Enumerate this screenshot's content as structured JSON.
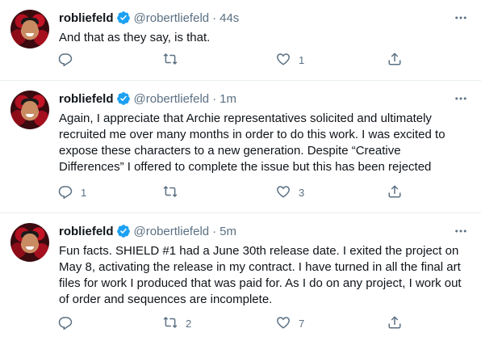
{
  "tweets": [
    {
      "name": "robliefeld",
      "handle": "@robertliefeld",
      "separator": "·",
      "time": "44s",
      "text": "And that as they say, is that.",
      "replies": "",
      "retweets": "",
      "likes": "1"
    },
    {
      "name": "robliefeld",
      "handle": "@robertliefeld",
      "separator": "·",
      "time": "1m",
      "text": "Again, I appreciate that Archie representatives solicited and ultimately recruited me over many months in order to do this work. I was excited to expose these characters to a new generation. Despite “Creative Differences” I offered to complete the issue but this has been rejected",
      "replies": "1",
      "retweets": "",
      "likes": "3"
    },
    {
      "name": "robliefeld",
      "handle": "@robertliefeld",
      "separator": "·",
      "time": "5m",
      "text": "Fun facts. SHIELD #1 had a June 30th release date. I exited the project on May 8, activating the release in my contract. I have turned in all the final art files for work I produced that was paid for. As I do on any project, I work out of order and sequences are incomplete.",
      "replies": "",
      "retweets": "2",
      "likes": "7"
    }
  ],
  "colors": {
    "accent": "#1da1f2",
    "muted": "#5b7083",
    "divider": "#e6ecf0"
  },
  "icons": [
    "verified-badge-icon",
    "more-icon",
    "reply-icon",
    "retweet-icon",
    "like-icon",
    "share-icon"
  ]
}
